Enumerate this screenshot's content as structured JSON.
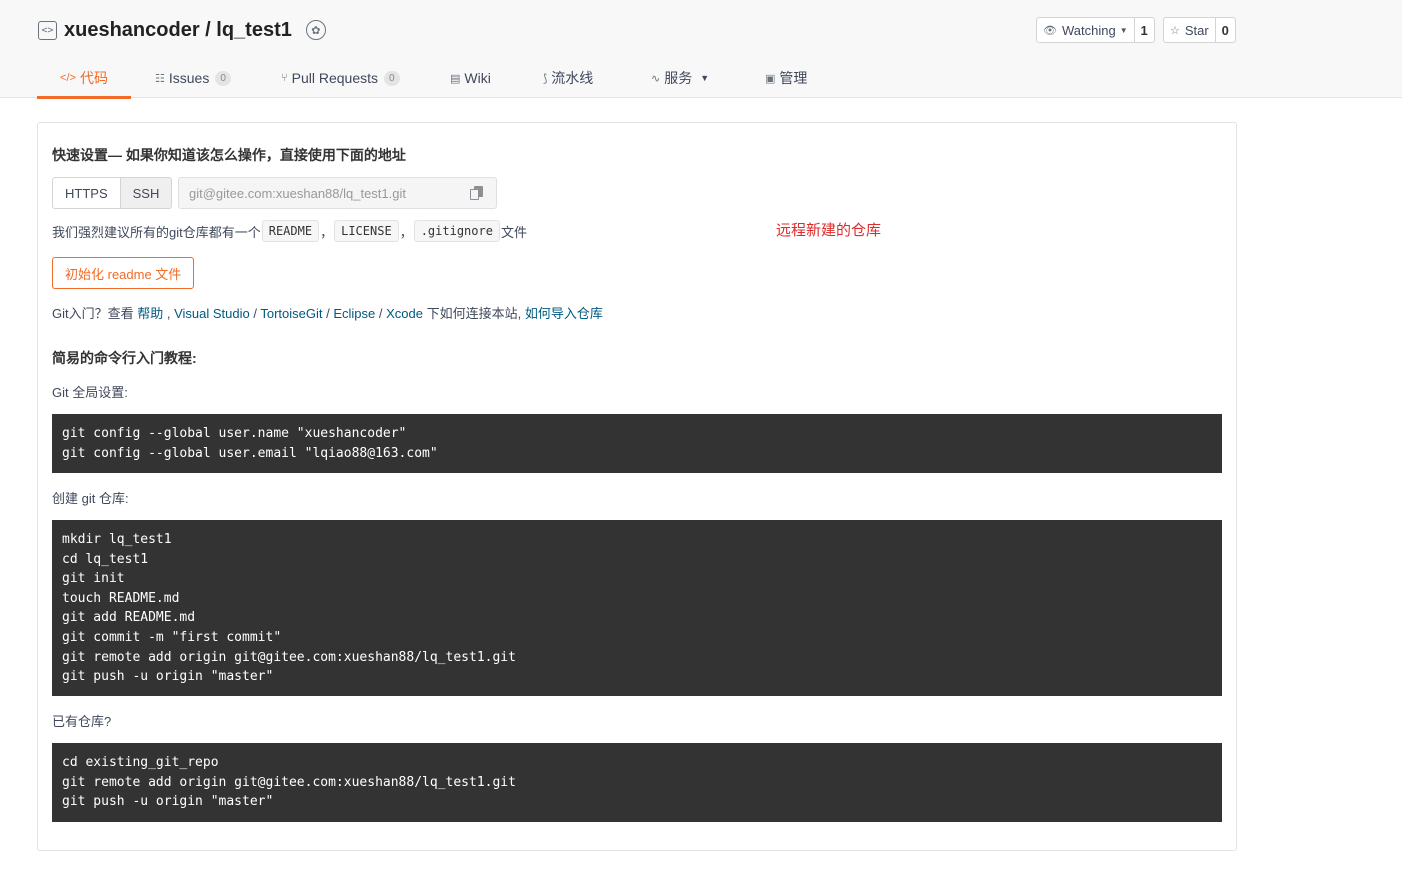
{
  "repo": {
    "owner": "xueshancoder",
    "separator": " / ",
    "name": "lq_test1"
  },
  "social": {
    "watch_label": "Watching",
    "watch_count": "1",
    "star_label": "Star",
    "star_count": "0"
  },
  "tabs": [
    {
      "label": "代码",
      "icon": "code-icon",
      "active": true
    },
    {
      "label": "Issues",
      "icon": "issues-icon",
      "count": "0"
    },
    {
      "label": "Pull Requests",
      "icon": "pull-request-icon",
      "count": "0"
    },
    {
      "label": "Wiki",
      "icon": "wiki-icon"
    },
    {
      "label": "流水线",
      "icon": "pipeline-icon"
    },
    {
      "label": "服务",
      "icon": "service-icon"
    },
    {
      "label": "管理",
      "icon": "manage-icon"
    }
  ],
  "quick_setup": {
    "title": "快速设置— 如果你知道该怎么操作，直接使用下面的地址",
    "https_label": "HTTPS",
    "ssh_label": "SSH",
    "url_placeholder": "git@gitee.com:xueshan88/lq_test1.git"
  },
  "recommend": {
    "prefix": "我们强烈建议所有的git仓库都有一个",
    "readme": "README",
    "license": "LICENSE",
    "gitignore": ".gitignore",
    "suffix": "文件",
    "comma": "，"
  },
  "annotation": "远程新建的仓库",
  "init_button": "初始化 readme 文件",
  "help": {
    "prefix": "Git入门？查看 ",
    "help_link": "帮助",
    "sep1": " , ",
    "vs": "Visual Studio",
    "slash": " / ",
    "tortoise": "TortoiseGit",
    "eclipse": "Eclipse",
    "xcode": "Xcode",
    "middle": " 下如何连接本站, ",
    "import_link": "如何导入仓库"
  },
  "cli": {
    "title": "简易的命令行入门教程:",
    "global_label": "Git 全局设置:",
    "global_cmds": [
      "git config --global user.name \"xueshancoder\"",
      "git config --global user.email \"lqiao88@163.com\""
    ],
    "create_label": "创建 git 仓库:",
    "create_cmds": [
      "mkdir lq_test1",
      "cd lq_test1",
      "git init",
      "touch README.md",
      "git add README.md",
      "git commit -m \"first commit\"",
      "git remote add origin git@gitee.com:xueshan88/lq_test1.git",
      "git push -u origin \"master\""
    ],
    "existing_label": "已有仓库?",
    "existing_cmds": [
      "cd existing_git_repo",
      "git remote add origin git@gitee.com:xueshan88/lq_test1.git",
      "git push -u origin \"master\""
    ]
  }
}
